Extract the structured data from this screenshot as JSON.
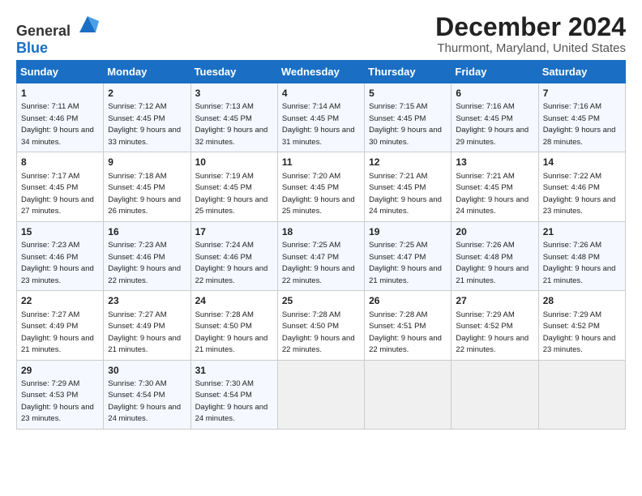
{
  "logo": {
    "general": "General",
    "blue": "Blue"
  },
  "title": "December 2024",
  "subtitle": "Thurmont, Maryland, United States",
  "days_of_week": [
    "Sunday",
    "Monday",
    "Tuesday",
    "Wednesday",
    "Thursday",
    "Friday",
    "Saturday"
  ],
  "weeks": [
    [
      {
        "day": 1,
        "sunrise": "7:11 AM",
        "sunset": "4:46 PM",
        "daylight": "9 hours and 34 minutes."
      },
      {
        "day": 2,
        "sunrise": "7:12 AM",
        "sunset": "4:45 PM",
        "daylight": "9 hours and 33 minutes."
      },
      {
        "day": 3,
        "sunrise": "7:13 AM",
        "sunset": "4:45 PM",
        "daylight": "9 hours and 32 minutes."
      },
      {
        "day": 4,
        "sunrise": "7:14 AM",
        "sunset": "4:45 PM",
        "daylight": "9 hours and 31 minutes."
      },
      {
        "day": 5,
        "sunrise": "7:15 AM",
        "sunset": "4:45 PM",
        "daylight": "9 hours and 30 minutes."
      },
      {
        "day": 6,
        "sunrise": "7:16 AM",
        "sunset": "4:45 PM",
        "daylight": "9 hours and 29 minutes."
      },
      {
        "day": 7,
        "sunrise": "7:16 AM",
        "sunset": "4:45 PM",
        "daylight": "9 hours and 28 minutes."
      }
    ],
    [
      {
        "day": 8,
        "sunrise": "7:17 AM",
        "sunset": "4:45 PM",
        "daylight": "9 hours and 27 minutes."
      },
      {
        "day": 9,
        "sunrise": "7:18 AM",
        "sunset": "4:45 PM",
        "daylight": "9 hours and 26 minutes."
      },
      {
        "day": 10,
        "sunrise": "7:19 AM",
        "sunset": "4:45 PM",
        "daylight": "9 hours and 25 minutes."
      },
      {
        "day": 11,
        "sunrise": "7:20 AM",
        "sunset": "4:45 PM",
        "daylight": "9 hours and 25 minutes."
      },
      {
        "day": 12,
        "sunrise": "7:21 AM",
        "sunset": "4:45 PM",
        "daylight": "9 hours and 24 minutes."
      },
      {
        "day": 13,
        "sunrise": "7:21 AM",
        "sunset": "4:45 PM",
        "daylight": "9 hours and 24 minutes."
      },
      {
        "day": 14,
        "sunrise": "7:22 AM",
        "sunset": "4:46 PM",
        "daylight": "9 hours and 23 minutes."
      }
    ],
    [
      {
        "day": 15,
        "sunrise": "7:23 AM",
        "sunset": "4:46 PM",
        "daylight": "9 hours and 23 minutes."
      },
      {
        "day": 16,
        "sunrise": "7:23 AM",
        "sunset": "4:46 PM",
        "daylight": "9 hours and 22 minutes."
      },
      {
        "day": 17,
        "sunrise": "7:24 AM",
        "sunset": "4:46 PM",
        "daylight": "9 hours and 22 minutes."
      },
      {
        "day": 18,
        "sunrise": "7:25 AM",
        "sunset": "4:47 PM",
        "daylight": "9 hours and 22 minutes."
      },
      {
        "day": 19,
        "sunrise": "7:25 AM",
        "sunset": "4:47 PM",
        "daylight": "9 hours and 21 minutes."
      },
      {
        "day": 20,
        "sunrise": "7:26 AM",
        "sunset": "4:48 PM",
        "daylight": "9 hours and 21 minutes."
      },
      {
        "day": 21,
        "sunrise": "7:26 AM",
        "sunset": "4:48 PM",
        "daylight": "9 hours and 21 minutes."
      }
    ],
    [
      {
        "day": 22,
        "sunrise": "7:27 AM",
        "sunset": "4:49 PM",
        "daylight": "9 hours and 21 minutes."
      },
      {
        "day": 23,
        "sunrise": "7:27 AM",
        "sunset": "4:49 PM",
        "daylight": "9 hours and 21 minutes."
      },
      {
        "day": 24,
        "sunrise": "7:28 AM",
        "sunset": "4:50 PM",
        "daylight": "9 hours and 21 minutes."
      },
      {
        "day": 25,
        "sunrise": "7:28 AM",
        "sunset": "4:50 PM",
        "daylight": "9 hours and 22 minutes."
      },
      {
        "day": 26,
        "sunrise": "7:28 AM",
        "sunset": "4:51 PM",
        "daylight": "9 hours and 22 minutes."
      },
      {
        "day": 27,
        "sunrise": "7:29 AM",
        "sunset": "4:52 PM",
        "daylight": "9 hours and 22 minutes."
      },
      {
        "day": 28,
        "sunrise": "7:29 AM",
        "sunset": "4:52 PM",
        "daylight": "9 hours and 23 minutes."
      }
    ],
    [
      {
        "day": 29,
        "sunrise": "7:29 AM",
        "sunset": "4:53 PM",
        "daylight": "9 hours and 23 minutes."
      },
      {
        "day": 30,
        "sunrise": "7:30 AM",
        "sunset": "4:54 PM",
        "daylight": "9 hours and 24 minutes."
      },
      {
        "day": 31,
        "sunrise": "7:30 AM",
        "sunset": "4:54 PM",
        "daylight": "9 hours and 24 minutes."
      },
      null,
      null,
      null,
      null
    ]
  ]
}
